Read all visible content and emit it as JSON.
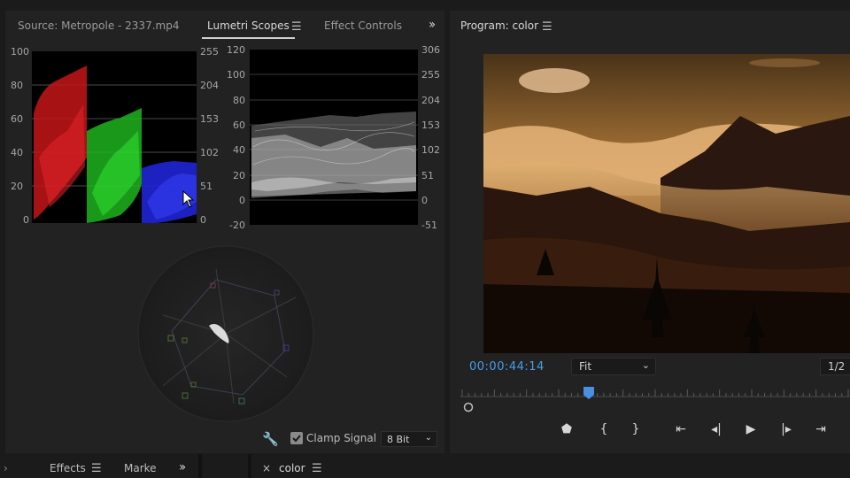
{
  "left_panel": {
    "tabs": [
      {
        "label": "Source: Metropole - 2337.mp4"
      },
      {
        "label": "Lumetri Scopes"
      },
      {
        "label": "Effect Controls"
      }
    ],
    "active_tab": "Lumetri Scopes"
  },
  "parade_scope": {
    "left_axis": [
      "100",
      "80",
      "60",
      "40",
      "20",
      "0"
    ],
    "right_axis": [
      "255",
      "204",
      "153",
      "102",
      "51",
      "0"
    ],
    "channels": [
      {
        "name": "red",
        "color": "#e0181c"
      },
      {
        "name": "green",
        "color": "#2bd92b"
      },
      {
        "name": "blue",
        "color": "#2a30f0"
      }
    ]
  },
  "waveform_scope": {
    "left_axis": [
      "120",
      "100",
      "80",
      "60",
      "40",
      "20",
      "0",
      "-20"
    ],
    "right_axis": [
      "306",
      "255",
      "204",
      "153",
      "102",
      "51",
      "0",
      "-51"
    ]
  },
  "scope_footer": {
    "clamp_label": "Clamp Signal",
    "clamp_checked": true,
    "bit_depth": "8 Bit",
    "wrench_icon": "wrench-icon"
  },
  "program_monitor": {
    "title": "Program: color",
    "timecode": "00:00:44:14",
    "zoom": "Fit",
    "resolution": "1/2",
    "playhead_position": 0.33
  },
  "bottom_bar": {
    "tabs": [
      {
        "label": "Effects"
      },
      {
        "label": "Marke"
      },
      {
        "label": "color"
      }
    ],
    "color_tab_close": "×"
  },
  "colors": {
    "accent_blue": "#4a9be8",
    "panel_bg": "#222222",
    "app_bg": "#1b1b1b"
  }
}
